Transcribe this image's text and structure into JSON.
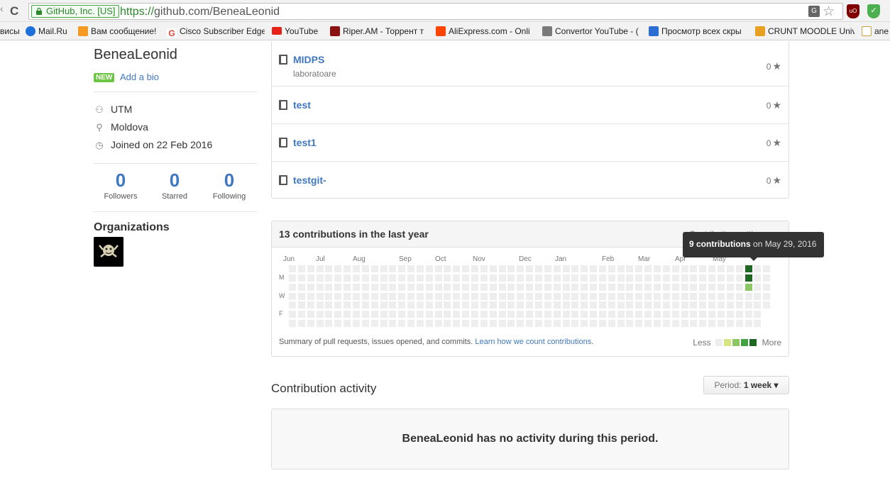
{
  "browser": {
    "ev_label": "GitHub, Inc. [US]",
    "url_scheme": "https://",
    "url_rest": "github.com/BeneaLeonid",
    "translate_glyph": "G",
    "ublock_label": "uO",
    "bookmarks": [
      {
        "label": "висы",
        "icon_color": "#f2f2f2"
      },
      {
        "label": "Mail.Ru",
        "icon_color": "#1e6fd9"
      },
      {
        "label": "Вам сообщение!",
        "icon_color": "#f59a23"
      },
      {
        "label": "Cisco Subscriber Edge",
        "icon_color": "#db4437"
      },
      {
        "label": "YouTube",
        "icon_color": "#e62117"
      },
      {
        "label": "Riper.AM - Торрент т",
        "icon_color": "#8b1010"
      },
      {
        "label": "AliExpress.com - Onli",
        "icon_color": "#ff4400"
      },
      {
        "label": "Convertor YouTube - (",
        "icon_color": "#7a7a7a"
      },
      {
        "label": "Просмотр всех скры",
        "icon_color": "#2b6dd1"
      },
      {
        "label": "CRUNT MOODLE Univ",
        "icon_color": "#e8a020"
      },
      {
        "label": "ane",
        "icon_color": "#e8c060"
      }
    ]
  },
  "profile": {
    "username": "BeneaLeonid",
    "new_badge": "NEW",
    "add_bio": "Add a bio",
    "organization": "UTM",
    "location": "Moldova",
    "joined": "Joined on 22 Feb 2016",
    "stats": [
      {
        "value": "0",
        "label": "Followers"
      },
      {
        "value": "0",
        "label": "Starred"
      },
      {
        "value": "0",
        "label": "Following"
      }
    ],
    "organizations_heading": "Organizations"
  },
  "repos": [
    {
      "name": "MIDPS",
      "description": "laboratoare",
      "stars": "0"
    },
    {
      "name": "test",
      "description": "",
      "stars": "0"
    },
    {
      "name": "test1",
      "description": "",
      "stars": "0"
    },
    {
      "name": "testgit-",
      "description": "",
      "stars": "0"
    }
  ],
  "contributions": {
    "title": "13 contributions in the last year",
    "settings_label": "Contribution settings ▾",
    "tooltip_count": "9 contributions",
    "tooltip_date": "on May 29, 2016",
    "months": [
      "Jun",
      "Jul",
      "Aug",
      "Sep",
      "Oct",
      "Nov",
      "Dec",
      "Jan",
      "Feb",
      "Mar",
      "Apr",
      "May"
    ],
    "weekdays": [
      "M",
      "W",
      "F"
    ],
    "footer_text": "Summary of pull requests, issues opened, and commits.",
    "footer_link": "Learn how we count contributions",
    "footer_period": ".",
    "legend_less": "Less",
    "legend_more": "More",
    "legend_colors": [
      "#eeeeee",
      "#d6e685",
      "#8cc665",
      "#44a340",
      "#1e6823"
    ],
    "empty_color": "#eeeeee",
    "active_cells": [
      {
        "week": 50,
        "day": 0,
        "color": "#1e6823"
      },
      {
        "week": 50,
        "day": 1,
        "color": "#1e6823"
      },
      {
        "week": 50,
        "day": 2,
        "color": "#8cc665"
      }
    ]
  },
  "activity": {
    "title": "Contribution activity",
    "period_label": "Period:",
    "period_value": "1 week ▾",
    "no_activity": "BeneaLeonid has no activity during this period."
  }
}
